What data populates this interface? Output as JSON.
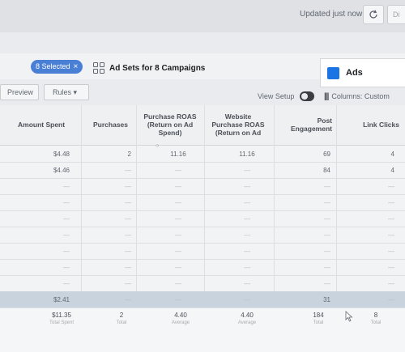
{
  "topbar": {
    "updated_text": "Updated just now",
    "discard_label": "Di",
    "refresh_icon": "refresh-icon"
  },
  "campaign_strip": {
    "selected_label": "8 Selected",
    "close_glyph": "×",
    "adsets_label": "Ad Sets for 8 Campaigns",
    "ads_label": "Ads"
  },
  "toolbar": {
    "preview_label": "Preview",
    "rules_label": "Rules ▾",
    "view_setup_label": "View Setup",
    "columns_label": "Columns: Custom"
  },
  "table": {
    "headers": [
      "Amount Spent",
      "Purchases",
      "Purchase ROAS (Return on Ad Spend)",
      "Website Purchase ROAS (Return on Ad",
      "Post Engagement",
      "Link Clicks"
    ],
    "rows": [
      [
        "$4.48",
        "2",
        "11.16",
        "11.16",
        "69",
        "4"
      ],
      [
        "$4.46",
        "—",
        "—",
        "—",
        "84",
        "4"
      ],
      [
        "—",
        "—",
        "—",
        "—",
        "—",
        "—"
      ],
      [
        "—",
        "—",
        "—",
        "—",
        "—",
        "—"
      ],
      [
        "—",
        "—",
        "—",
        "—",
        "—",
        "—"
      ],
      [
        "—",
        "—",
        "—",
        "—",
        "—",
        "—"
      ],
      [
        "—",
        "—",
        "—",
        "—",
        "—",
        "—"
      ],
      [
        "—",
        "—",
        "—",
        "—",
        "—",
        "—"
      ],
      [
        "—",
        "—",
        "—",
        "—",
        "—",
        "—"
      ],
      [
        "$2.41",
        "—",
        "—",
        "—",
        "31",
        "—"
      ]
    ],
    "totals": [
      {
        "value": "$11.35",
        "sub": "Total Spent"
      },
      {
        "value": "2",
        "sub": "Total"
      },
      {
        "value": "4.40",
        "sub": "Average"
      },
      {
        "value": "4.40",
        "sub": "Average"
      },
      {
        "value": "184",
        "sub": "Total"
      },
      {
        "value": "8",
        "sub": "Total"
      }
    ]
  }
}
